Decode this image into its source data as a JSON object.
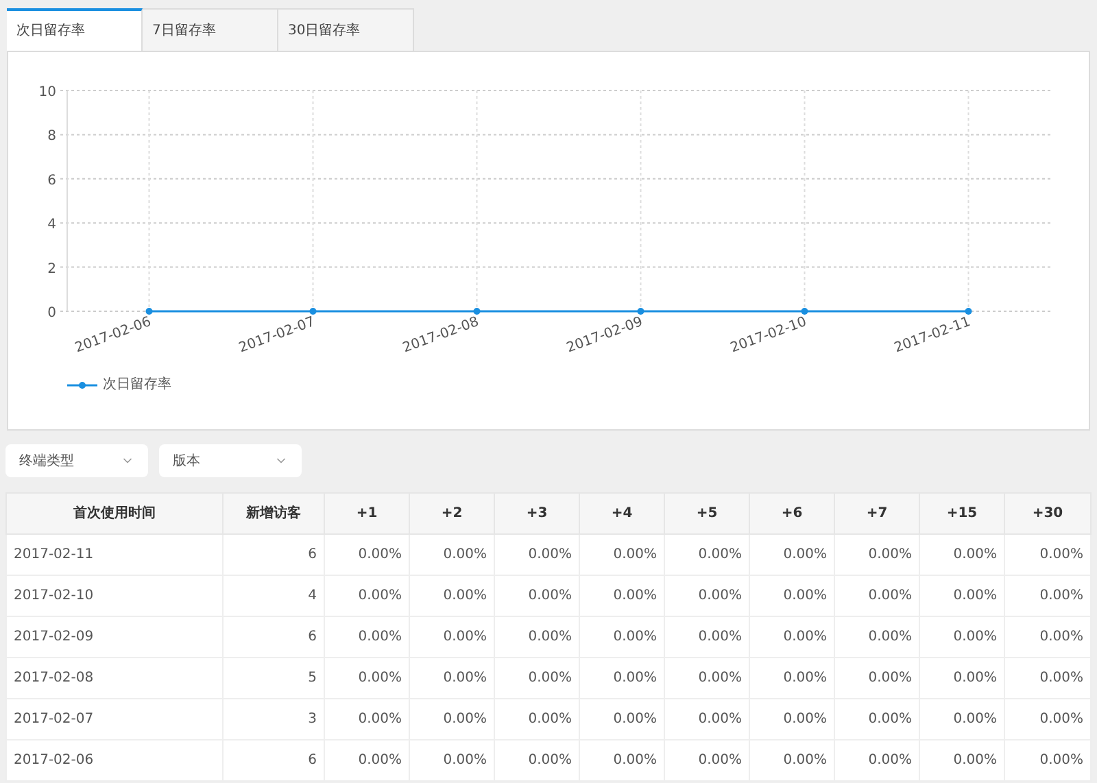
{
  "tabs": [
    {
      "label": "次日留存率",
      "selected": true
    },
    {
      "label": "7日留存率",
      "selected": false
    },
    {
      "label": "30日留存率",
      "selected": false
    }
  ],
  "chart": {
    "chart_data": {
      "type": "line",
      "categories": [
        "2017-02-06",
        "2017-02-07",
        "2017-02-08",
        "2017-02-09",
        "2017-02-10",
        "2017-02-11"
      ],
      "series": [
        {
          "name": "次日留存率",
          "color": "#1a8fe0",
          "marker": true,
          "values": [
            0,
            0,
            0,
            0,
            0,
            0
          ]
        }
      ],
      "grid": true,
      "ylim": [
        0,
        10
      ],
      "yticks": [
        0,
        2,
        4,
        6,
        8,
        10
      ]
    }
  },
  "filters": [
    {
      "label": "终端类型"
    },
    {
      "label": "版本"
    }
  ],
  "table": {
    "columns": [
      "首次使用时间",
      "新增访客",
      "+1",
      "+2",
      "+3",
      "+4",
      "+5",
      "+6",
      "+7",
      "+15",
      "+30"
    ],
    "rows": [
      [
        "2017-02-11",
        "6",
        "0.00%",
        "0.00%",
        "0.00%",
        "0.00%",
        "0.00%",
        "0.00%",
        "0.00%",
        "0.00%",
        "0.00%"
      ],
      [
        "2017-02-10",
        "4",
        "0.00%",
        "0.00%",
        "0.00%",
        "0.00%",
        "0.00%",
        "0.00%",
        "0.00%",
        "0.00%",
        "0.00%"
      ],
      [
        "2017-02-09",
        "6",
        "0.00%",
        "0.00%",
        "0.00%",
        "0.00%",
        "0.00%",
        "0.00%",
        "0.00%",
        "0.00%",
        "0.00%"
      ],
      [
        "2017-02-08",
        "5",
        "0.00%",
        "0.00%",
        "0.00%",
        "0.00%",
        "0.00%",
        "0.00%",
        "0.00%",
        "0.00%",
        "0.00%"
      ],
      [
        "2017-02-07",
        "3",
        "0.00%",
        "0.00%",
        "0.00%",
        "0.00%",
        "0.00%",
        "0.00%",
        "0.00%",
        "0.00%",
        "0.00%"
      ],
      [
        "2017-02-06",
        "6",
        "0.00%",
        "0.00%",
        "0.00%",
        "0.00%",
        "0.00%",
        "0.00%",
        "0.00%",
        "0.00%",
        "0.00%"
      ]
    ]
  }
}
